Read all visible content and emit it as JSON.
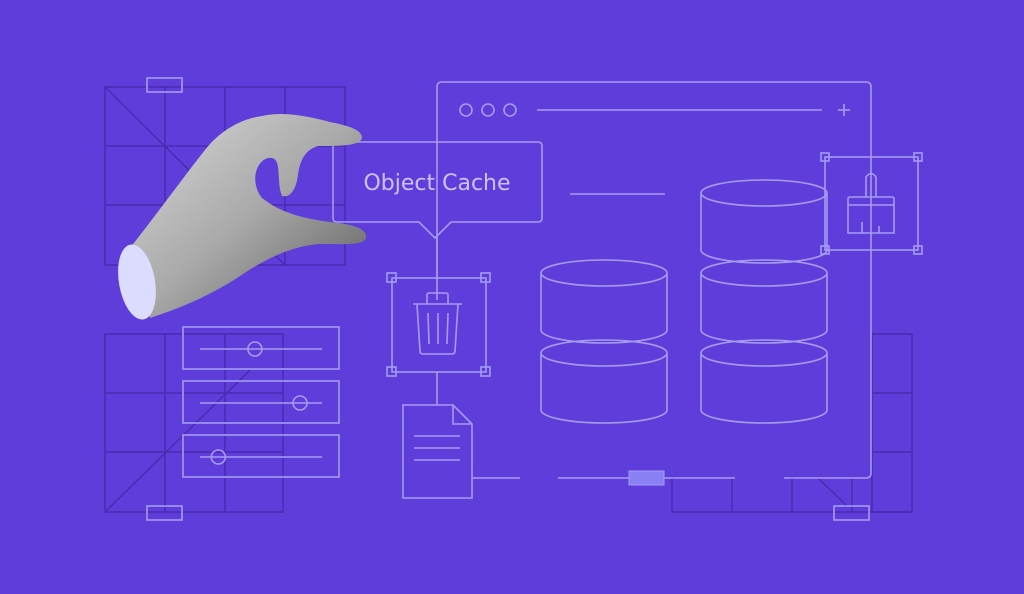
{
  "illustration": {
    "title_label": "Object Cache",
    "colors": {
      "background": "#5f3ddb",
      "line_light": "#a59cf2",
      "line_dark": "#4a2bb0",
      "accent_fill": "#8a80f5",
      "cuff": "#dcdcff"
    },
    "browser_window": {
      "controls": [
        "circle-icon",
        "circle-icon",
        "circle-icon"
      ],
      "new_tab_icon": "plus-icon"
    },
    "icons": [
      "trash-icon",
      "document-icon",
      "brush-icon",
      "database-icon"
    ],
    "sliders": [
      {
        "value": 0.45
      },
      {
        "value": 0.82
      },
      {
        "value": 0.15
      }
    ],
    "databases": [
      {
        "stack": 2
      },
      {
        "stack": 3
      }
    ]
  }
}
